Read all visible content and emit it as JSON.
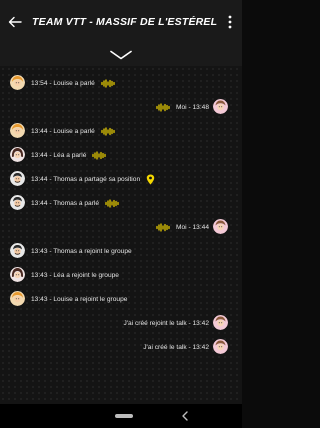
{
  "header": {
    "title": "TEAM VTT - MASSIF DE L'ESTÉREL"
  },
  "colors": {
    "accent": "#f5d800",
    "header_bg": "#1a1a1a"
  },
  "messages": [
    {
      "side": "left",
      "avatar": "avatar-louise",
      "text": "13:54 - Louise a parlé",
      "extra": "audio-wave-icon"
    },
    {
      "side": "right",
      "avatar": "avatar-self",
      "text": "Moi - 13:48",
      "extra": "audio-wave-icon"
    },
    {
      "side": "left",
      "avatar": "avatar-louise",
      "text": "13:44 - Louise a parlé",
      "extra": "audio-wave-icon"
    },
    {
      "side": "left",
      "avatar": "avatar-lea",
      "text": "13:44 - Léa a parlé",
      "extra": "audio-wave-icon"
    },
    {
      "side": "left",
      "avatar": "avatar-thomas",
      "text": "13:44 - Thomas a partagé sa position",
      "extra": "location-pin-icon"
    },
    {
      "side": "left",
      "avatar": "avatar-thomas",
      "text": "13:44 - Thomas a parlé",
      "extra": "audio-wave-icon"
    },
    {
      "side": "right",
      "avatar": "avatar-self",
      "text": "Moi - 13:44",
      "extra": "audio-wave-icon"
    },
    {
      "side": "left",
      "avatar": "avatar-thomas",
      "text": "13:43 - Thomas a rejoint le groupe",
      "extra": ""
    },
    {
      "side": "left",
      "avatar": "avatar-lea",
      "text": "13:43 - Léa a rejoint le groupe",
      "extra": ""
    },
    {
      "side": "left",
      "avatar": "avatar-louise",
      "text": "13:43 - Louise a rejoint le groupe",
      "extra": ""
    },
    {
      "side": "right",
      "avatar": "avatar-self",
      "text": "J'ai créé rejoint le talk - 13:42",
      "extra": ""
    },
    {
      "side": "right",
      "avatar": "avatar-self",
      "text": "J'ai créé le talk - 13:42",
      "extra": ""
    }
  ]
}
